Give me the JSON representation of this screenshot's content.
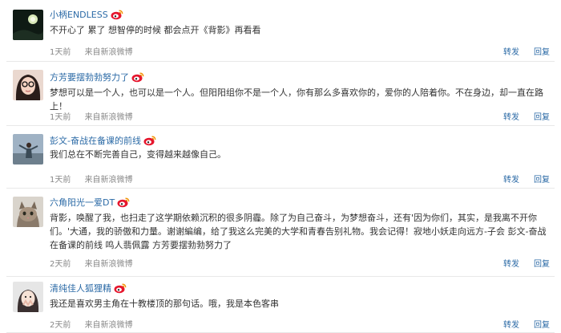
{
  "posts": [
    {
      "username": "小柄ENDLESS",
      "content": "不开心了 累了 想智停的时候 都会点开《背影》再看看",
      "time": "1天前",
      "source": "来自新浪微博",
      "repost": "转发",
      "reply": "回复"
    },
    {
      "username": "方芳要摆勃勃努力了",
      "content": "梦想可以是一个人，也可以是一个人。但阳阳组你不是一个人，你有那么多喜欢你的，爱你的人陪着你。不在身边，却一直在路上！",
      "time": "1天前",
      "source": "来自新浪微博",
      "repost": "转发",
      "reply": "回复"
    },
    {
      "username": "彭文-奋战在备课的前线",
      "content": "我们总在不断完善自己，变得越来越像自己。",
      "time": "1天前",
      "source": "来自新浪微博",
      "repost": "转发",
      "reply": "回复"
    },
    {
      "username": "六角阳光一爱DT",
      "content": "背影，唤醒了我，也扫走了这学期依赖沉积的很多阴霾。除了为自己奋斗，为梦想奋斗，还有'因为你们，其实，是我离不开你们。'大通，我的骄傲和力量。谢谢編编，给了我这么完美的大学和青春告别礼物。我会记得！寂地小妖走向远方-子会 彭文-奋战在备课的前线 鸣人翡佩露 方芳要摆勃勃努力了",
      "time": "2天前",
      "source": "来自新浪微博",
      "repost": "转发",
      "reply": "回复"
    },
    {
      "username": "清纯佳人狐狸精",
      "content": "我还是喜欢男主角在十教楼顶的那句话。哦，我是本色客串",
      "time": "2天前",
      "source": "来自新浪微博",
      "repost": "转发",
      "reply": "回复"
    }
  ],
  "colors": {
    "link": "#2b6aa6",
    "text": "#333333",
    "meta": "#888888",
    "badge": "#e6162d"
  }
}
